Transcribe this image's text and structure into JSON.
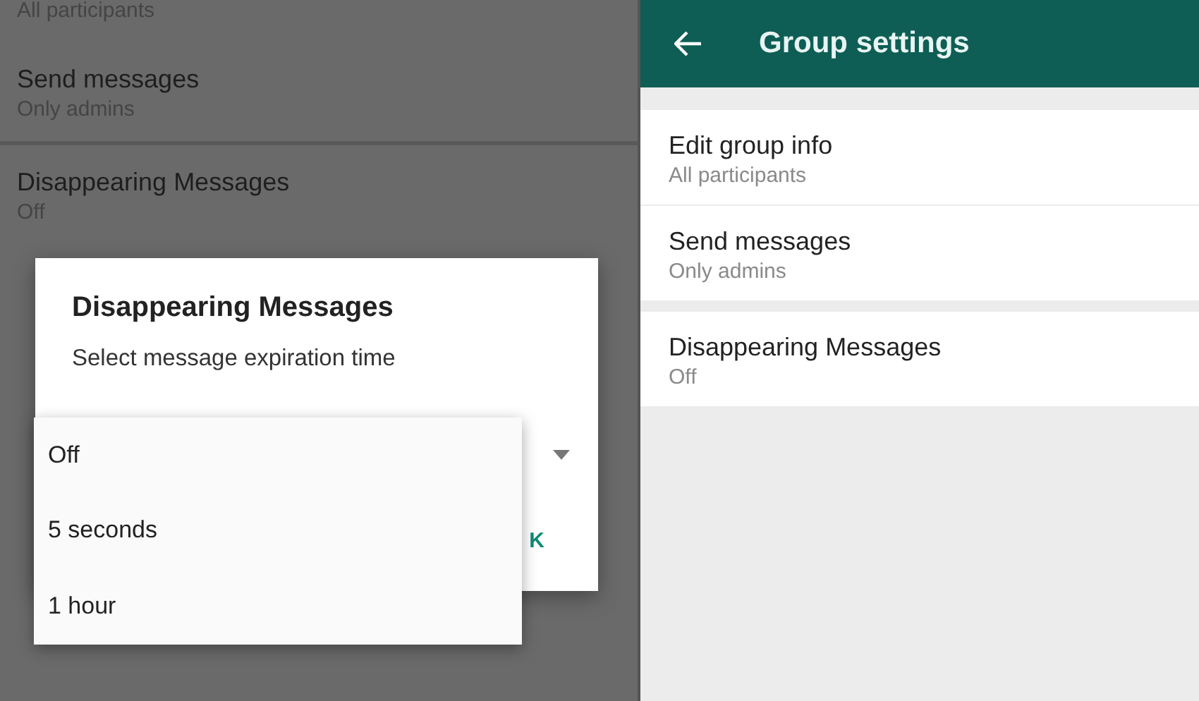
{
  "background_sections": [
    [
      {
        "subtitle": "All participants"
      },
      {
        "title": "Send messages",
        "subtitle": "Only admins"
      }
    ],
    [
      {
        "title": "Disappearing Messages",
        "subtitle": "Off"
      }
    ]
  ],
  "dialog": {
    "title": "Disappearing Messages",
    "message": "Select message expiration time",
    "button": "K",
    "menu": [
      {
        "label": "Off"
      },
      {
        "label": "5 seconds"
      },
      {
        "label": "1 hour"
      }
    ]
  },
  "group_settings": {
    "title": "Group settings",
    "sections": [
      [
        {
          "title": "Edit group info",
          "subtitle": "All participants"
        },
        {
          "title": "Send messages",
          "subtitle": "Only admins"
        }
      ],
      [
        {
          "title": "Disappearing Messages",
          "subtitle": "Off"
        }
      ]
    ]
  }
}
